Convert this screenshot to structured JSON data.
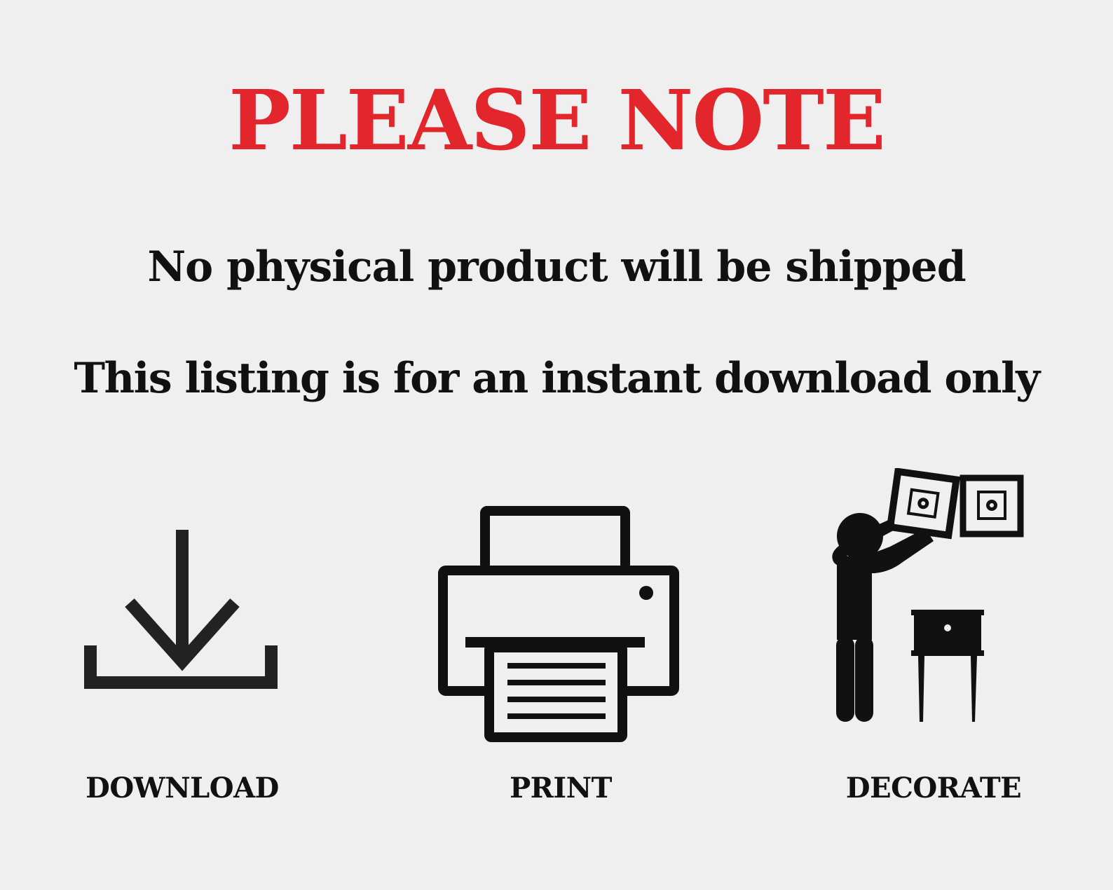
{
  "heading": "PLEASE NOTE",
  "notes": {
    "line1": "No physical product will be shipped",
    "line2": "This listing is for an instant download only"
  },
  "steps": {
    "download": {
      "label": "DOWNLOAD",
      "icon": "download-icon"
    },
    "print": {
      "label": "PRINT",
      "icon": "printer-icon"
    },
    "decorate": {
      "label": "DECORATE",
      "icon": "person-hanging-picture-icon"
    }
  },
  "colors": {
    "background": "#efefef",
    "heading": "#e3262b",
    "text": "#111111"
  }
}
